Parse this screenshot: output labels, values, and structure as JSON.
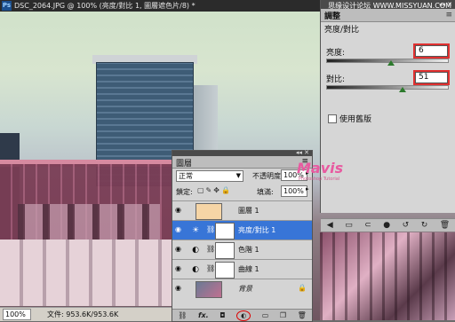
{
  "document": {
    "title": "DSC_2064.JPG @ 100% (亮度/對比 1, 圖層遮色片/8) *",
    "ps_icon": "Ps",
    "zoom": "100%",
    "doc_size": "文件: 953.6K/953.6K"
  },
  "watermark": {
    "top": "思缘设计论坛  WWW.MISSYUAN.COM",
    "brand": "Mavis",
    "brand_sub": "Photoshop Tutorial"
  },
  "adjustments": {
    "tab_label": "調整",
    "header": "亮度/對比",
    "brightness_label": "亮度:",
    "brightness_value": "6",
    "contrast_label": "對比:",
    "contrast_value": "51",
    "legacy_label": "使用舊版",
    "window_controls": "◂◂ ✕",
    "brightness_level": 0.54,
    "contrast_level": 0.63
  },
  "layers": {
    "tab_label": "圖層",
    "blend_mode": "正常",
    "opacity_label": "不透明度:",
    "opacity_value": "100%",
    "lock_label": "鎖定:",
    "fill_label": "填滿:",
    "fill_value": "100%",
    "window_controls": "◂◂ ✕",
    "rows": [
      {
        "name": "圖層 1",
        "selected": false
      },
      {
        "name": "亮度/對比 1",
        "selected": true
      },
      {
        "name": "色階 1",
        "selected": false
      },
      {
        "name": "曲線 1",
        "selected": false
      },
      {
        "name": "背景",
        "selected": false
      }
    ]
  },
  "icons": {
    "eye": "eye-icon",
    "link": "link-icon",
    "lock": "lock-icon",
    "fx": "fx-icon",
    "mask": "add-mask-icon",
    "adjustment": "new-adjustment-icon",
    "group": "group-icon",
    "new_layer": "new-layer-icon",
    "trash": "trash-icon"
  },
  "colors": {
    "selected": "#3875d7",
    "highlight": "#e03030"
  }
}
